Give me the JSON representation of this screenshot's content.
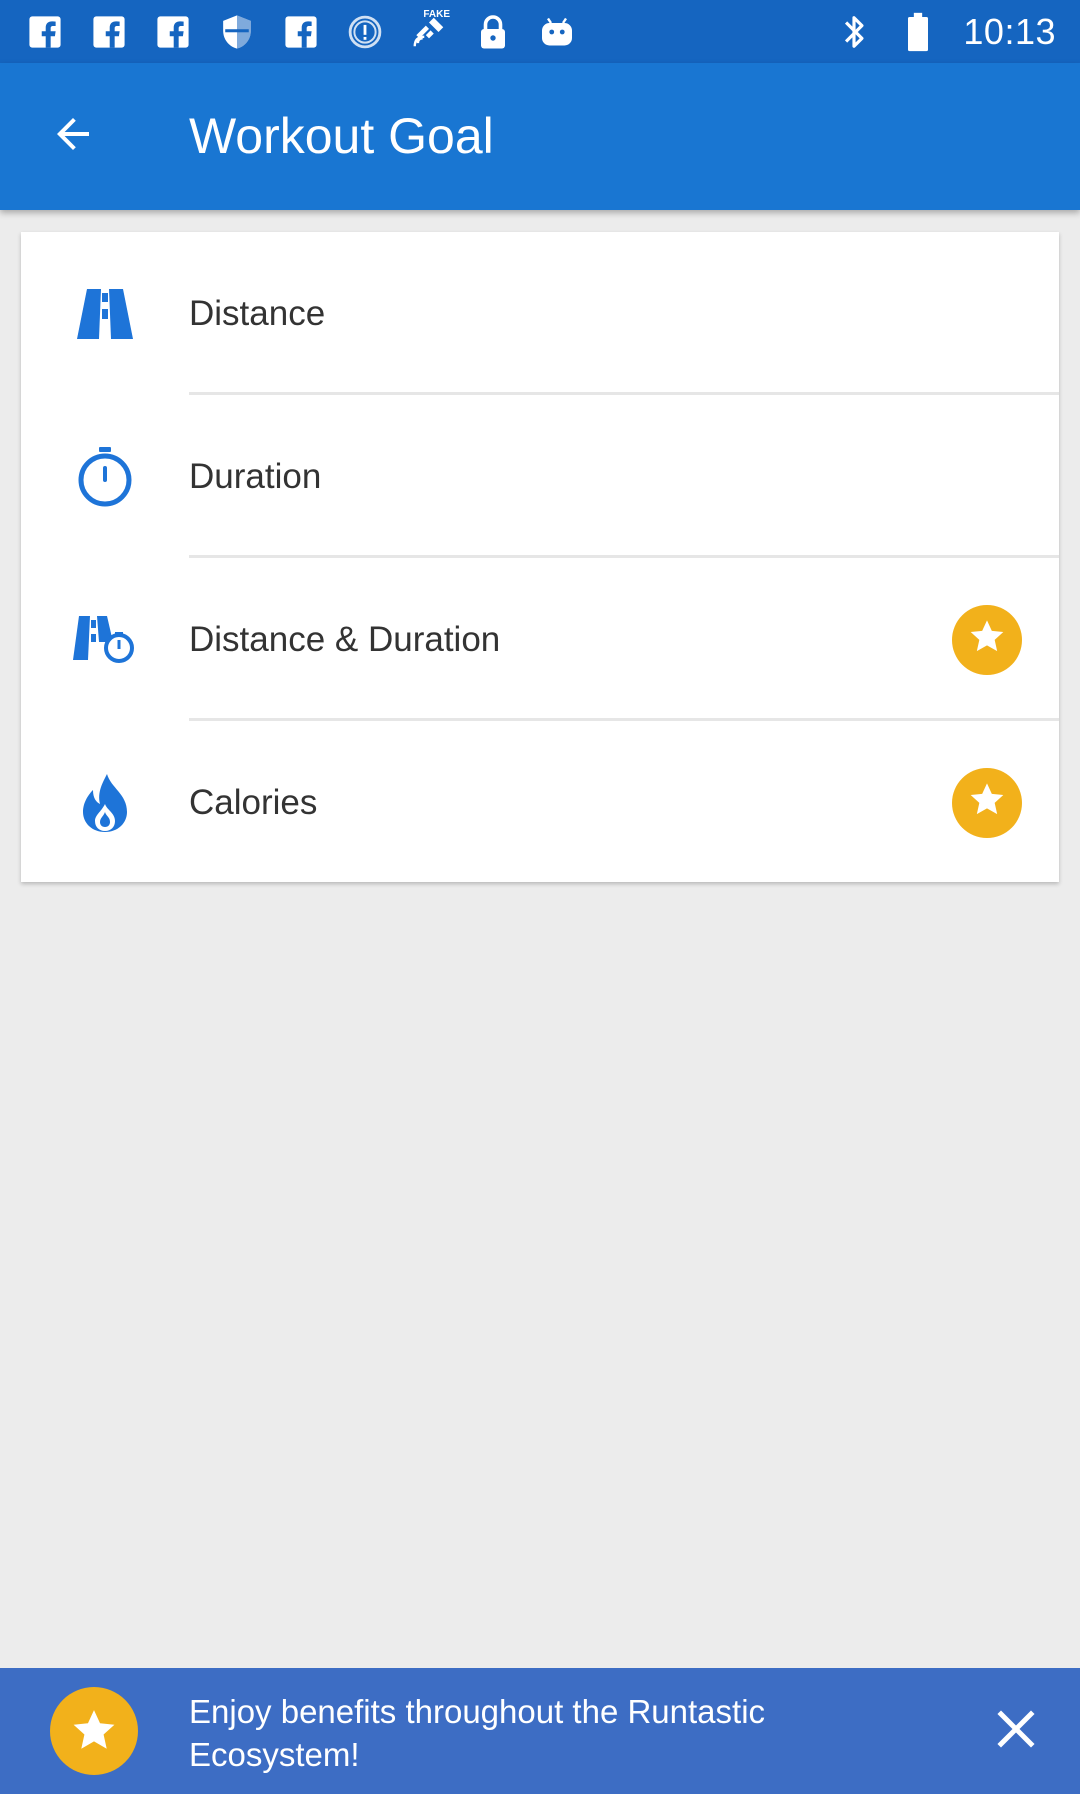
{
  "status_bar": {
    "time": "10:13",
    "left_icons": [
      "facebook-icon",
      "facebook-icon",
      "facebook-icon",
      "shield-icon",
      "facebook-icon",
      "info-circle-icon",
      "fake-gps-satellite-icon",
      "lock-icon",
      "android-icon"
    ],
    "right_icons": [
      "bluetooth-icon",
      "battery-icon"
    ],
    "fake_gps_badge": "FAKE"
  },
  "app_bar": {
    "title": "Workout Goal",
    "back_icon": "arrow-back-icon"
  },
  "goals": [
    {
      "label": "Distance",
      "icon": "road-icon",
      "premium": false
    },
    {
      "label": "Duration",
      "icon": "stopwatch-icon",
      "premium": false
    },
    {
      "label": "Distance & Duration",
      "icon": "road-stopwatch-icon",
      "premium": true
    },
    {
      "label": "Calories",
      "icon": "flame-icon",
      "premium": true
    }
  ],
  "banner": {
    "text": "Enjoy benefits throughout the Runtastic Ecosystem!",
    "star_icon": "star-icon",
    "close_icon": "close-icon"
  },
  "colors": {
    "status_bar": "#1565c0",
    "app_bar": "#1976d2",
    "icon_blue": "#1e74d8",
    "premium_gold": "#f2b11b",
    "banner": "#3d6dc4",
    "background": "#ececec"
  }
}
